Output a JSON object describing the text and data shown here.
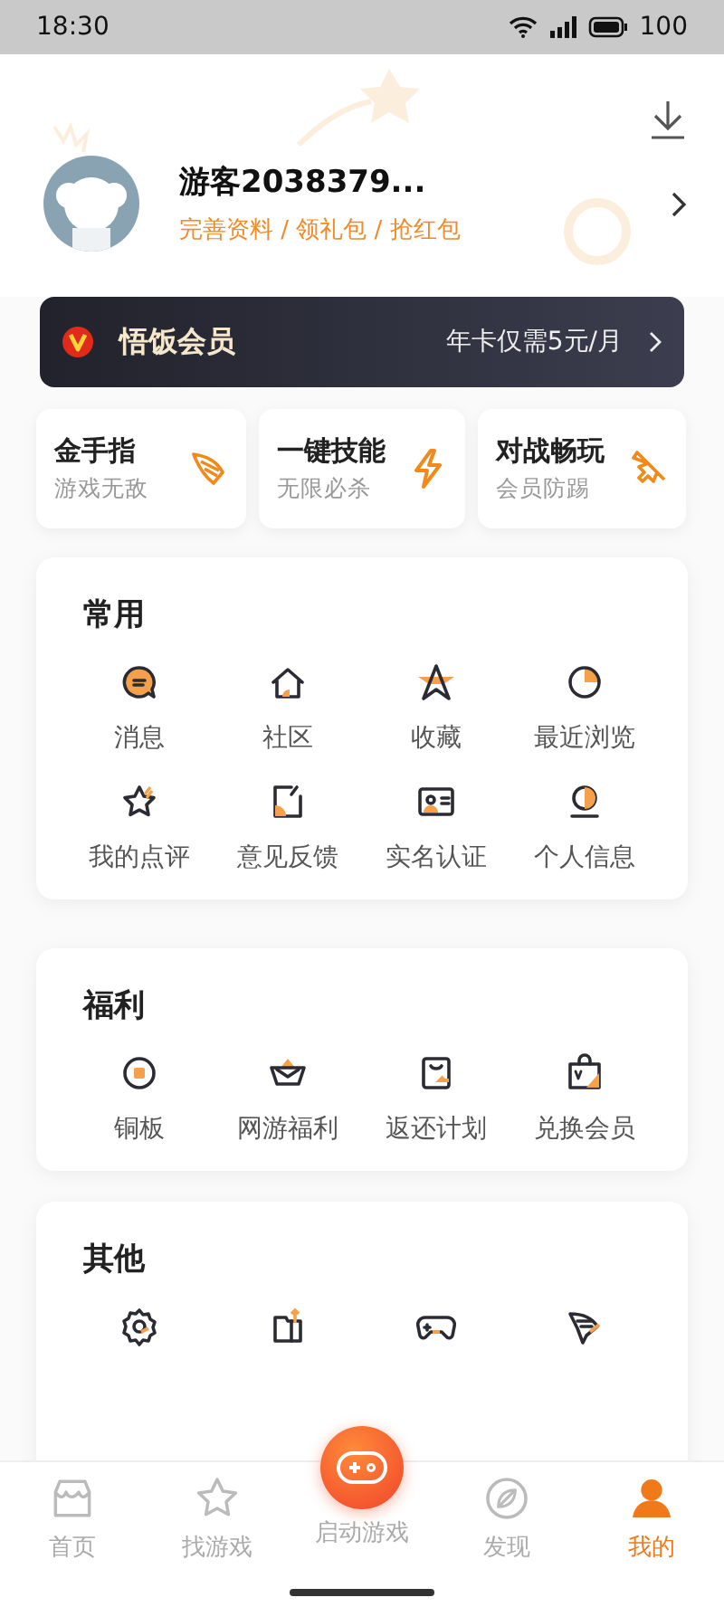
{
  "status_bar": {
    "time": "18:30",
    "battery": "100"
  },
  "profile": {
    "name": "游客2038379...",
    "subtitle": "完善资料 / 领礼包 / 抢红包"
  },
  "vip": {
    "title": "悟饭会员",
    "offer": "年卡仅需5元/月"
  },
  "perks": [
    {
      "title": "金手指",
      "subtitle": "游戏无敌"
    },
    {
      "title": "一键技能",
      "subtitle": "无限必杀"
    },
    {
      "title": "对战畅玩",
      "subtitle": "会员防踢"
    }
  ],
  "sections": [
    {
      "title": "常用",
      "items": [
        {
          "label": "消息"
        },
        {
          "label": "社区"
        },
        {
          "label": "收藏"
        },
        {
          "label": "最近浏览"
        },
        {
          "label": "我的点评"
        },
        {
          "label": "意见反馈"
        },
        {
          "label": "实名认证"
        },
        {
          "label": "个人信息"
        }
      ]
    },
    {
      "title": "福利",
      "items": [
        {
          "label": "铜板"
        },
        {
          "label": "网游福利"
        },
        {
          "label": "返还计划"
        },
        {
          "label": "兑换会员"
        }
      ]
    },
    {
      "title": "其他"
    }
  ],
  "tabs": [
    {
      "kind": "tab",
      "label": "首页",
      "selected": false
    },
    {
      "kind": "tab",
      "label": "找游戏",
      "selected": false
    },
    {
      "kind": "launch",
      "label": "启动游戏",
      "selected": false
    },
    {
      "kind": "tab",
      "label": "发现",
      "selected": false
    },
    {
      "kind": "tab",
      "label": "我的",
      "selected": true
    }
  ]
}
